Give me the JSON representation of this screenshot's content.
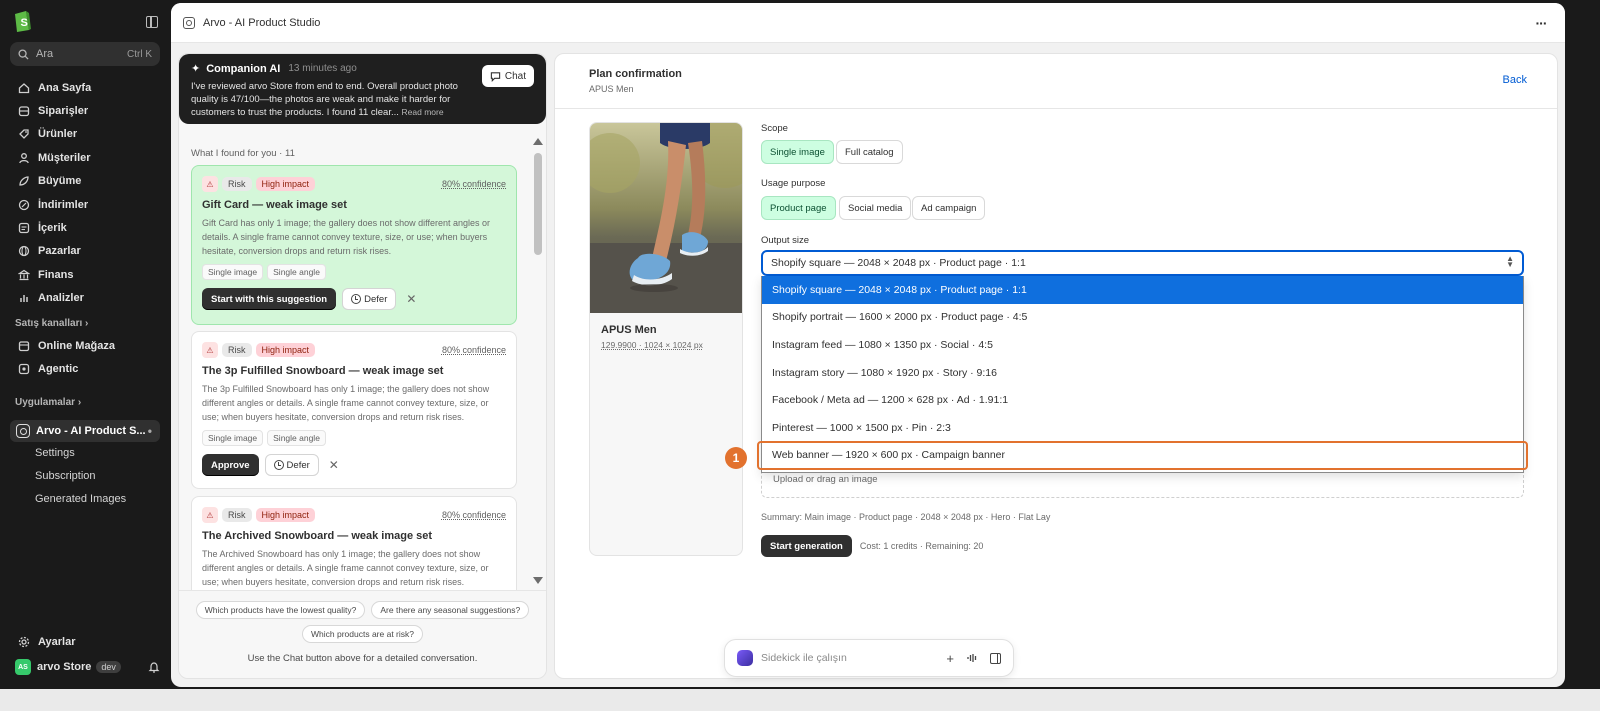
{
  "sidebar": {
    "search_placeholder": "Ara",
    "search_shortcut": "Ctrl K",
    "nav": [
      {
        "label": "Ana Sayfa",
        "icon": "home-icon"
      },
      {
        "label": "Siparişler",
        "icon": "orders-icon"
      },
      {
        "label": "Ürünler",
        "icon": "products-icon"
      },
      {
        "label": "Müşteriler",
        "icon": "customers-icon"
      },
      {
        "label": "Büyüme",
        "icon": "growth-icon"
      },
      {
        "label": "İndirimler",
        "icon": "discounts-icon"
      },
      {
        "label": "İçerik",
        "icon": "content-icon"
      },
      {
        "label": "Pazarlar",
        "icon": "markets-icon"
      },
      {
        "label": "Finans",
        "icon": "finance-icon"
      },
      {
        "label": "Analizler",
        "icon": "analytics-icon"
      }
    ],
    "sales_channels_label": "Satış kanalları",
    "sales_channels": [
      {
        "label": "Online Mağaza",
        "icon": "online-store-icon"
      },
      {
        "label": "Agentic",
        "icon": "agentic-icon"
      }
    ],
    "apps_label": "Uygulamalar",
    "active_app": "Arvo - AI Product S...",
    "app_sub_items": [
      "Settings",
      "Subscription",
      "Generated Images"
    ],
    "settings_label": "Ayarlar",
    "store_initials": "AS",
    "store_name": "arvo Store",
    "store_badge": "dev"
  },
  "topbar": {
    "title": "Arvo - AI Product Studio"
  },
  "companion": {
    "title": "Companion AI",
    "time": "13 minutes ago",
    "description": "I've reviewed arvo Store from end to end. Overall product photo quality is 47/100—the photos are weak and make it harder for customers to trust the products. I found 11 clear...",
    "read_more": "Read more",
    "chat_label": "Chat",
    "found_label": "What I found for you · 11",
    "cards": [
      {
        "tag_risk": "Risk",
        "tag_impact": "High impact",
        "confidence": "80% confidence",
        "title": "Gift Card — weak image set",
        "body": "Gift Card has only 1 image; the gallery does not show different angles or details. A single frame cannot convey texture, size, or use; when buyers hesitate, conversion drops and return risk rises.",
        "chips": [
          "Single image",
          "Single angle"
        ],
        "primary": "Start with this suggestion",
        "defer": "Defer"
      },
      {
        "tag_risk": "Risk",
        "tag_impact": "High impact",
        "confidence": "80% confidence",
        "title": "The 3p Fulfilled Snowboard — weak image set",
        "body": "The 3p Fulfilled Snowboard has only 1 image; the gallery does not show different angles or details. A single frame cannot convey texture, size, or use; when buyers hesitate, conversion drops and return risk rises.",
        "chips": [
          "Single image",
          "Single angle"
        ],
        "primary": "Approve",
        "defer": "Defer"
      },
      {
        "tag_risk": "Risk",
        "tag_impact": "High impact",
        "confidence": "80% confidence",
        "title": "The Archived Snowboard — weak image set",
        "body": "The Archived Snowboard has only 1 image; the gallery does not show different angles or details. A single frame cannot convey texture, size, or use; when buyers hesitate, conversion drops and return risk rises."
      }
    ],
    "suggestions": [
      "Which products have the lowest quality?",
      "Are there any seasonal suggestions?",
      "Which products are at risk?"
    ],
    "footer": "Use the Chat button above for a detailed conversation."
  },
  "plan": {
    "title": "Plan confirmation",
    "subtitle": "APUS Men",
    "back_label": "Back",
    "product_name": "APUS Men",
    "product_meta": "129.9900 · 1024 × 1024 px",
    "scope_label": "Scope",
    "scope_options": [
      "Single image",
      "Full catalog"
    ],
    "scope_selected": "Single image",
    "usage_label": "Usage purpose",
    "usage_options": [
      "Product page",
      "Social media",
      "Ad campaign"
    ],
    "usage_selected": "Product page",
    "output_label": "Output size",
    "output_value": "Shopify square — 2048 × 2048 px · Product page · 1:1",
    "output_options": [
      "Shopify square — 2048 × 2048 px · Product page · 1:1",
      "Shopify portrait — 1600 × 2000 px · Product page · 4:5",
      "Instagram feed — 1080 × 1350 px · Social · 4:5",
      "Instagram story — 1080 × 1920 px · Story · 9:16",
      "Facebook / Meta ad — 1200 × 628 px · Ad · 1.91:1",
      "Pinterest — 1000 × 1500 px · Pin · 2:3",
      "Web banner — 1920 × 600 px · Campaign banner"
    ],
    "highlight_badge": "1",
    "upload_text": "Upload or drag an image",
    "summary": "Summary: Main image · Product page · 2048 × 2048 px · Hero · Flat Lay",
    "generate_label": "Start generation",
    "cost_text": "Cost: 1 credits · Remaining: 20"
  },
  "sidekick": {
    "placeholder": "Sidekick ile çalışın"
  },
  "colors": {
    "sidebar_bg": "#1a1a1a",
    "accent_blue": "#005bd3",
    "selected_green": "#cdfee1",
    "active_card_green": "#d4f7d9",
    "highlight_orange": "#e2722e"
  }
}
